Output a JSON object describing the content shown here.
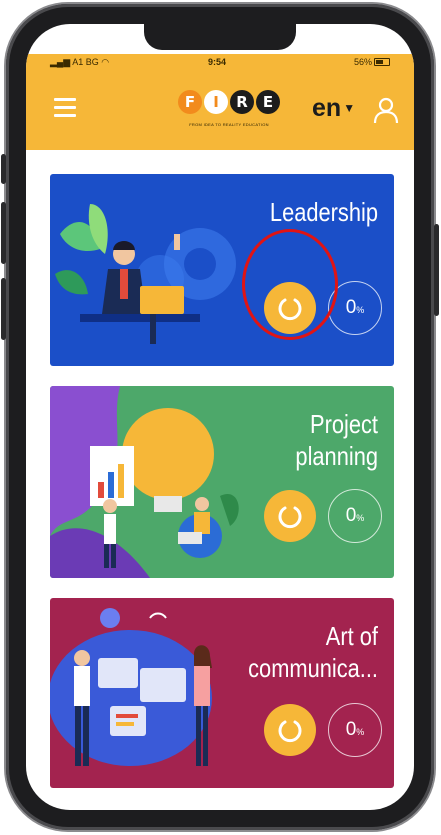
{
  "status_bar": {
    "carrier": "A1 BG",
    "time": "9:54",
    "battery": "56%"
  },
  "header": {
    "logo_letters": [
      "F",
      "I",
      "R",
      "E"
    ],
    "logo_tagline": "FROM IDEA TO REALITY EDUCATION",
    "language": "en"
  },
  "icons": {
    "menu": "hamburger-menu-icon",
    "user": "user-profile-icon",
    "start": "power-restart-icon",
    "caret": "caret-down-icon"
  },
  "colors": {
    "accent": "#f6b738",
    "leadership": "#1b4fc8",
    "project": "#4da86a",
    "communication": "#a3234f",
    "annotation": "#e01414"
  },
  "courses": [
    {
      "title": "Leadership",
      "progress": "0",
      "unit": "%"
    },
    {
      "title": "Project\nplanning",
      "progress": "0",
      "unit": "%"
    },
    {
      "title": "Art of\ncommunica...",
      "progress": "0",
      "unit": "%"
    }
  ]
}
